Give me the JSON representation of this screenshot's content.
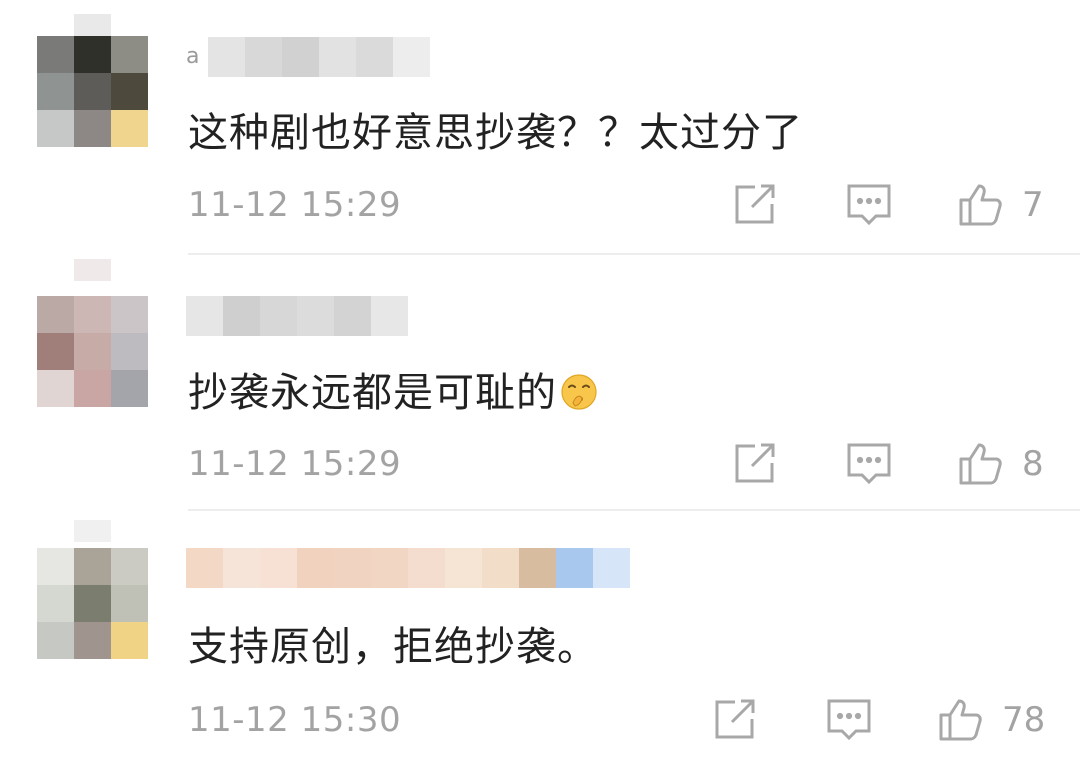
{
  "comments": [
    {
      "name_lead": "a",
      "text": "这种剧也好意思抄袭？？太过分了",
      "time": "11-12 15:29",
      "likes": "7",
      "avatar": [
        "#7a7b78",
        "#2f3029",
        "#8e8d85",
        "#8f9391",
        "#5e5c58",
        "#4d4a3d",
        "#c5c8c7",
        "#8d8885",
        "#efd58e"
      ],
      "avatar_ghost": "#e9e9e9",
      "name_blocks": [
        "#e4e4e4",
        "#d8d8d8",
        "#d1d1d1",
        "#e2e2e2",
        "#dadada",
        "#ededed"
      ]
    },
    {
      "text": "抄袭永远都是可耻的",
      "emoji": "shush-face-emoji",
      "time": "11-12 15:29",
      "likes": "8",
      "avatar": [
        "#bba9a6",
        "#ccb7b4",
        "#cbc5c7",
        "#a07f7b",
        "#c7aba7",
        "#bdbbc0",
        "#e0d5d3",
        "#c9a5a3",
        "#a3a5ab"
      ],
      "avatar_ghost": "#efe9e9",
      "name_blocks": [
        "#e6e6e6",
        "#cfcfcf",
        "#d7d7d7",
        "#dcdcdc",
        "#d3d3d3",
        "#e7e7e7"
      ]
    },
    {
      "text": "支持原创，拒绝抄袭。",
      "time": "11-12 15:30",
      "likes": "78",
      "avatar": [
        "#e6e6e3",
        "#a9a497",
        "#cccbc3",
        "#d4d8d0",
        "#7b7d6e",
        "#bfc1b6",
        "#c6c8c4",
        "#9f958e",
        "#f1d386"
      ],
      "avatar_ghost": "#f0f0f0",
      "name_blocks": [
        "#f3d9c5",
        "#f7e4d8",
        "#f6e1d4",
        "#f0d2bf",
        "#f0d3c0",
        "#f2d6c4",
        "#f4ddce",
        "#f6e4d4",
        "#f2ddc8",
        "#d8bc9f",
        "#a8c8ee",
        "#d6e5f7"
      ]
    }
  ],
  "icons": {
    "share": "share-icon",
    "reply": "reply-icon",
    "like": "thumbs-up-icon"
  },
  "colors": {
    "text": "#222222",
    "meta": "#a3a3a3",
    "icon": "#a8a8a8"
  }
}
